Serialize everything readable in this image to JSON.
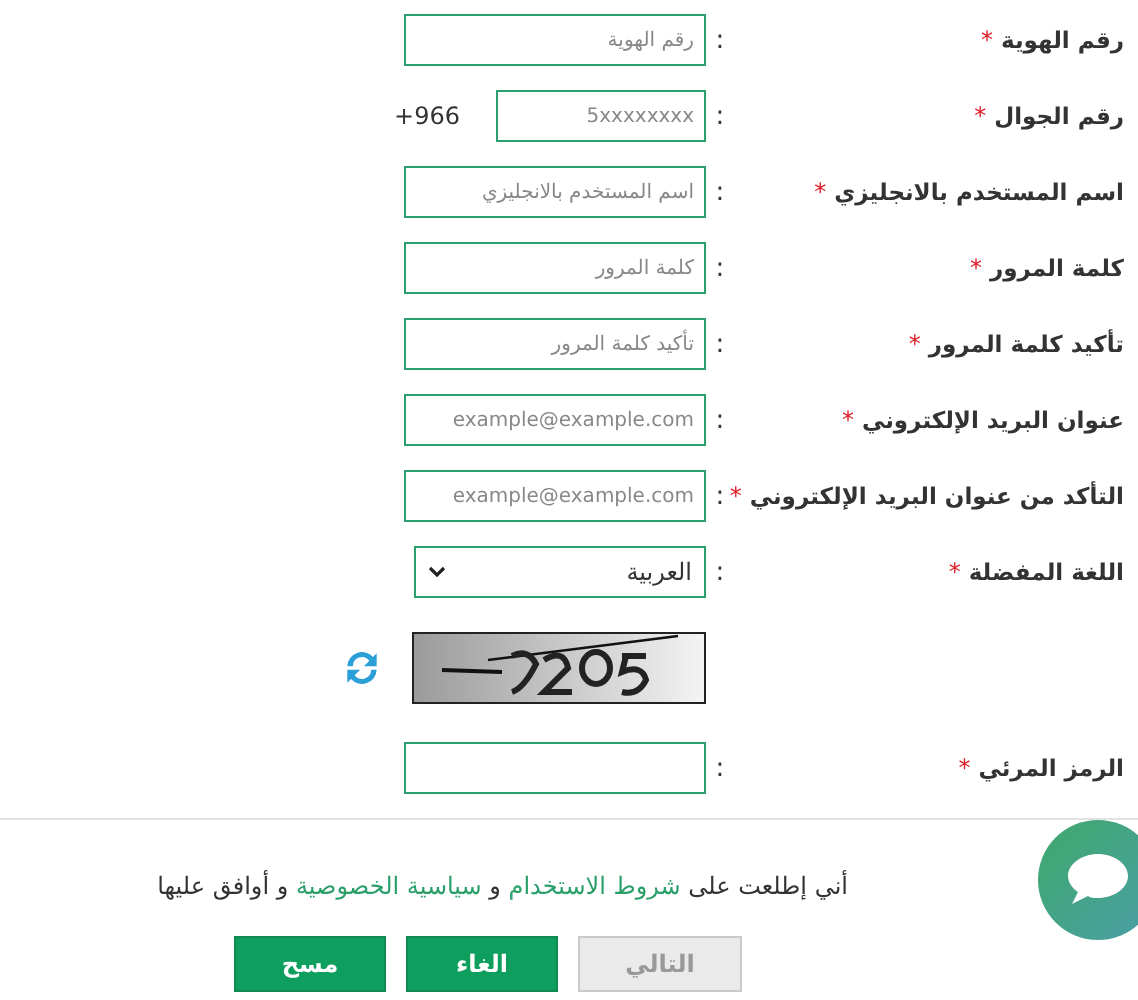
{
  "fields": [
    {
      "kind": "text",
      "label": "رقم الهوية",
      "required_mark": "*",
      "colon": ":",
      "placeholder": "رقم الهوية"
    },
    {
      "kind": "phone",
      "label": "رقم الجوال",
      "required_mark": "*",
      "colon": ":",
      "placeholder": "5xxxxxxxx",
      "prefix": "+966"
    },
    {
      "kind": "text",
      "label": "اسم المستخدم بالانجليزي",
      "required_mark": "*",
      "colon": ":",
      "placeholder": "اسم المستخدم بالانجليزي"
    },
    {
      "kind": "text",
      "label": "كلمة المرور",
      "required_mark": "*",
      "colon": ":",
      "placeholder": "كلمة المرور"
    },
    {
      "kind": "text",
      "label": "تأكيد كلمة المرور",
      "required_mark": "*",
      "colon": ":",
      "placeholder": "تأكيد كلمة المرور"
    },
    {
      "kind": "text",
      "label": "عنوان البريد الإلكتروني",
      "required_mark": "*",
      "colon": ":",
      "placeholder": "example@example.com"
    },
    {
      "kind": "text",
      "label": "التأكد من عنوان البريد الإلكتروني",
      "required_mark": "*",
      "colon": ":",
      "placeholder": "example@example.com"
    },
    {
      "kind": "select",
      "label": "اللغة المفضلة",
      "required_mark": "*",
      "colon": ":",
      "value": "العربية"
    },
    {
      "kind": "captcha"
    },
    {
      "kind": "text",
      "label": "الرمز المرئي",
      "required_mark": "*",
      "colon": ":"
    }
  ],
  "terms": [
    {
      "kind": "plain",
      "text": "أني إطلعت على "
    },
    {
      "kind": "link",
      "text": "شروط الاستخدام"
    },
    {
      "kind": "plain",
      "text": " و "
    },
    {
      "kind": "link",
      "text": "سياسية الخصوصية"
    },
    {
      "kind": "plain",
      "text": " و أوافق عليها"
    }
  ],
  "buttons": [
    {
      "label": "التالي",
      "disabled": true
    },
    {
      "label": "الغاء",
      "disabled": false
    },
    {
      "label": "مسح",
      "disabled": false
    }
  ]
}
